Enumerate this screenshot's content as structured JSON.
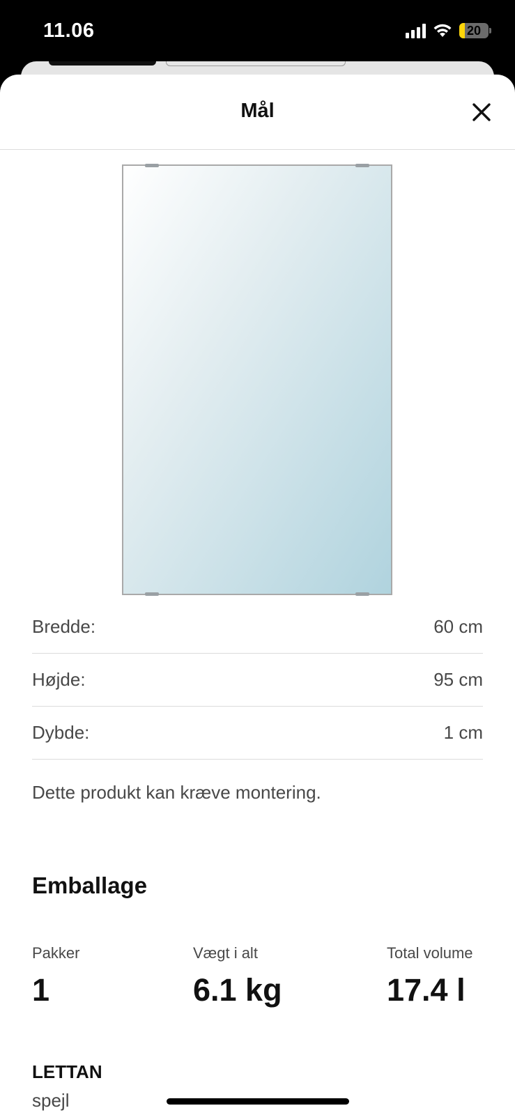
{
  "status_bar": {
    "time": "11.06",
    "battery_level": "20"
  },
  "sheet": {
    "title": "Mål",
    "close_icon": "close-icon"
  },
  "dimensions": [
    {
      "label": "Bredde:",
      "value": "60 cm"
    },
    {
      "label": "Højde:",
      "value": "95 cm"
    },
    {
      "label": "Dybde:",
      "value": "1 cm"
    }
  ],
  "assembly_note": "Dette produkt kan kræve montering.",
  "packaging": {
    "heading": "Emballage",
    "packages_label": "Pakker",
    "packages_value": "1",
    "weight_label": "Vægt i alt",
    "weight_value": "6.1 kg",
    "volume_label": "Total volume",
    "volume_value": "17.4 l"
  },
  "product": {
    "name": "LETTAN",
    "type": "spejl"
  },
  "colors": {
    "mirror_light": "#f4f6f7",
    "mirror_dark": "#b6d6e0",
    "battery_fill": "#ffd60a"
  }
}
